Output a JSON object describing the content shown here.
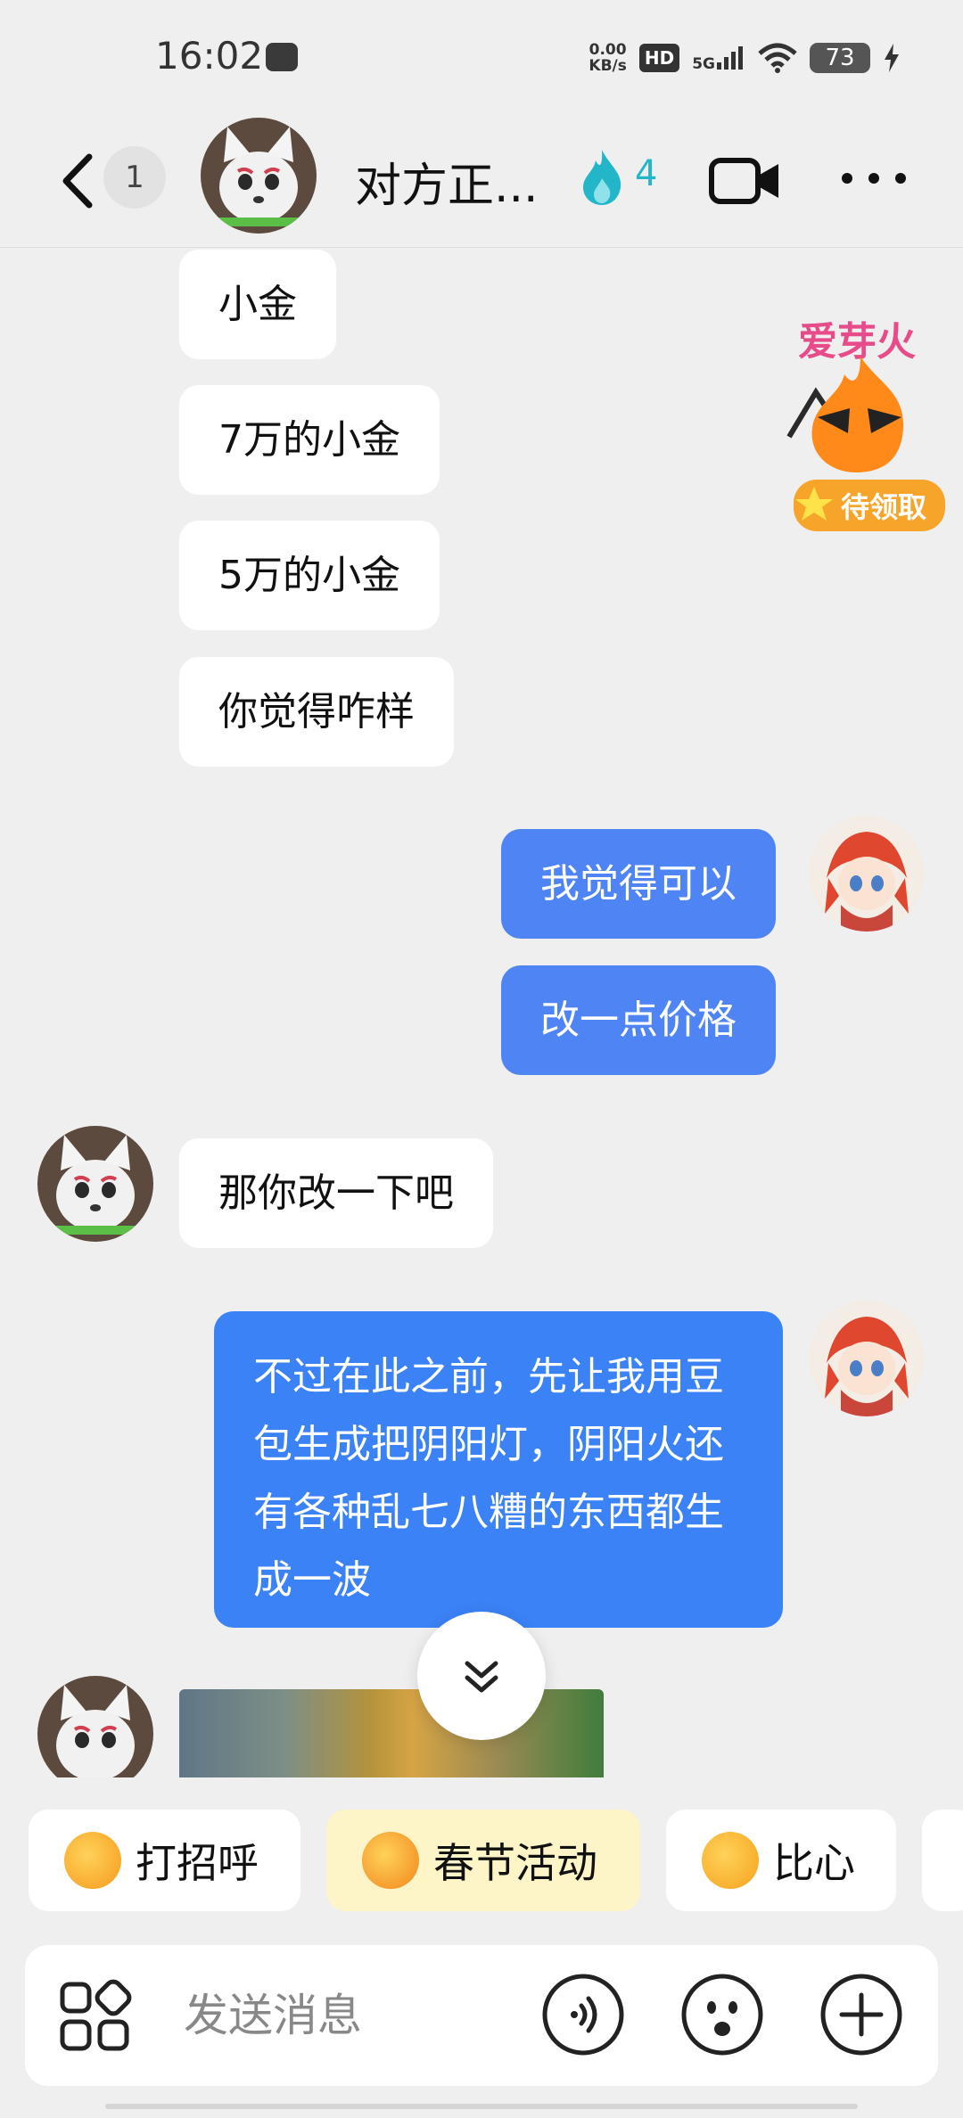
{
  "status_bar": {
    "time": "16:02",
    "net_speed_value": "0.00",
    "net_speed_unit": "KB/s",
    "hd_label": "HD",
    "network_label": "5G",
    "battery_level": "73"
  },
  "header": {
    "unread_count": "1",
    "title": "对方正...",
    "flame_count": "4"
  },
  "messages": [
    {
      "side": "in",
      "text": "小金"
    },
    {
      "side": "in",
      "text": "7万的小金"
    },
    {
      "side": "in",
      "text": "5万的小金"
    },
    {
      "side": "in",
      "text": "你觉得咋样"
    },
    {
      "side": "out",
      "text": "我觉得可以"
    },
    {
      "side": "out",
      "text": "改一点价格"
    },
    {
      "side": "in",
      "text": "那你改一下吧"
    },
    {
      "side": "out",
      "text": "不过在此之前，先让我用豆包生成把阴阳灯，阴阳火还有各种乱七八糟的东西都生成一波"
    },
    {
      "side": "in",
      "type": "image"
    }
  ],
  "promo_badge": {
    "banner_text": "爱芽火",
    "label": "待领取"
  },
  "quick_replies": [
    {
      "label": "打招呼",
      "emoji": "waving-hand-emoji"
    },
    {
      "label": "春节活动",
      "emoji": "spring-festival-emoji"
    },
    {
      "label": "比心",
      "emoji": "heart-hands-emoji"
    }
  ],
  "input_bar": {
    "placeholder": "发送消息"
  },
  "colors": {
    "outgoing_bubble": "#4f84f5",
    "outgoing_bubble_long": "#3b82f6",
    "incoming_bubble": "#ffffff",
    "background": "#efefef",
    "flame": "#22b6c8",
    "chip_highlight": "#fdf4c8"
  }
}
